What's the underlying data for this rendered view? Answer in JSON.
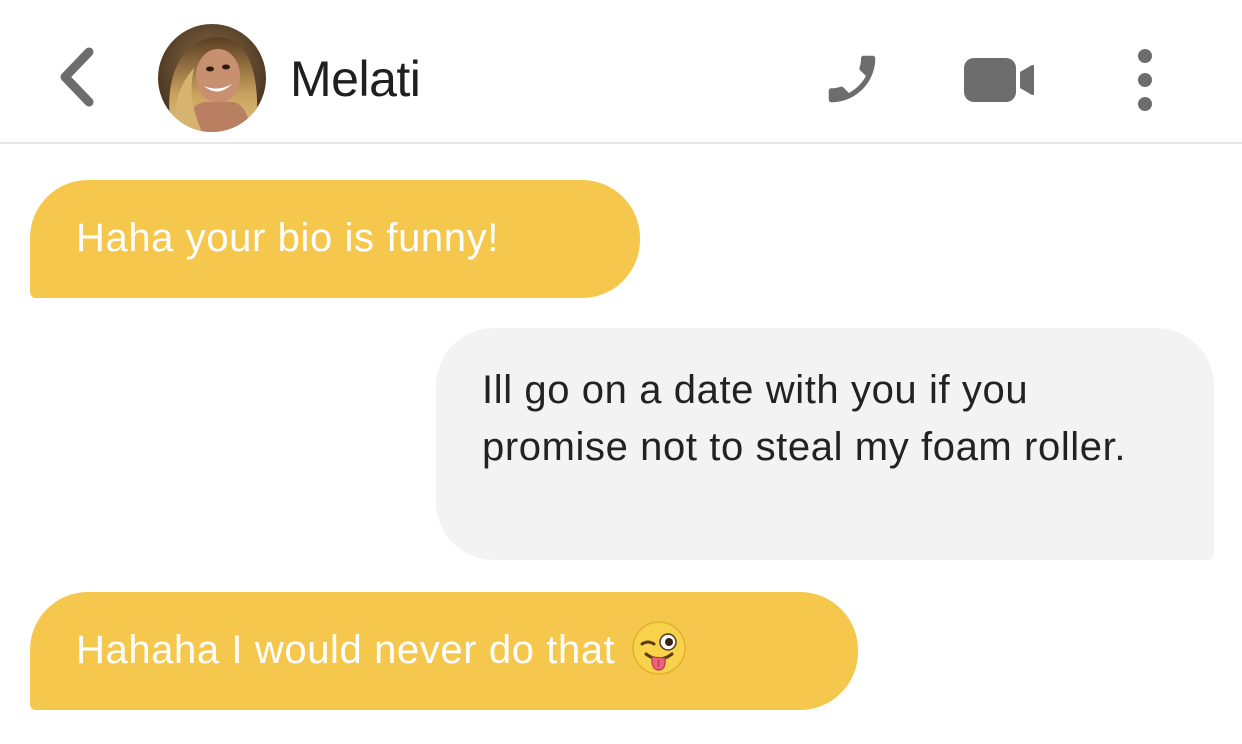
{
  "header": {
    "contact_name": "Melati",
    "back_icon": "chevron-left-icon",
    "call_icon": "phone-icon",
    "video_icon": "video-camera-icon",
    "menu_icon": "more-vertical-icon",
    "icon_color": "#6d6d6d"
  },
  "messages": [
    {
      "direction": "incoming",
      "text": "Haha your bio is funny!"
    },
    {
      "direction": "outgoing",
      "text": "Ill go on a date with you if you promise not to steal my foam roller."
    },
    {
      "direction": "incoming",
      "text": "Hahaha I would never do that",
      "emoji": "winking-face-with-tongue"
    }
  ],
  "colors": {
    "incoming_bubble": "#f5c74d",
    "outgoing_bubble": "#f3f3f3",
    "incoming_text": "#ffffff",
    "outgoing_text": "#222222"
  }
}
